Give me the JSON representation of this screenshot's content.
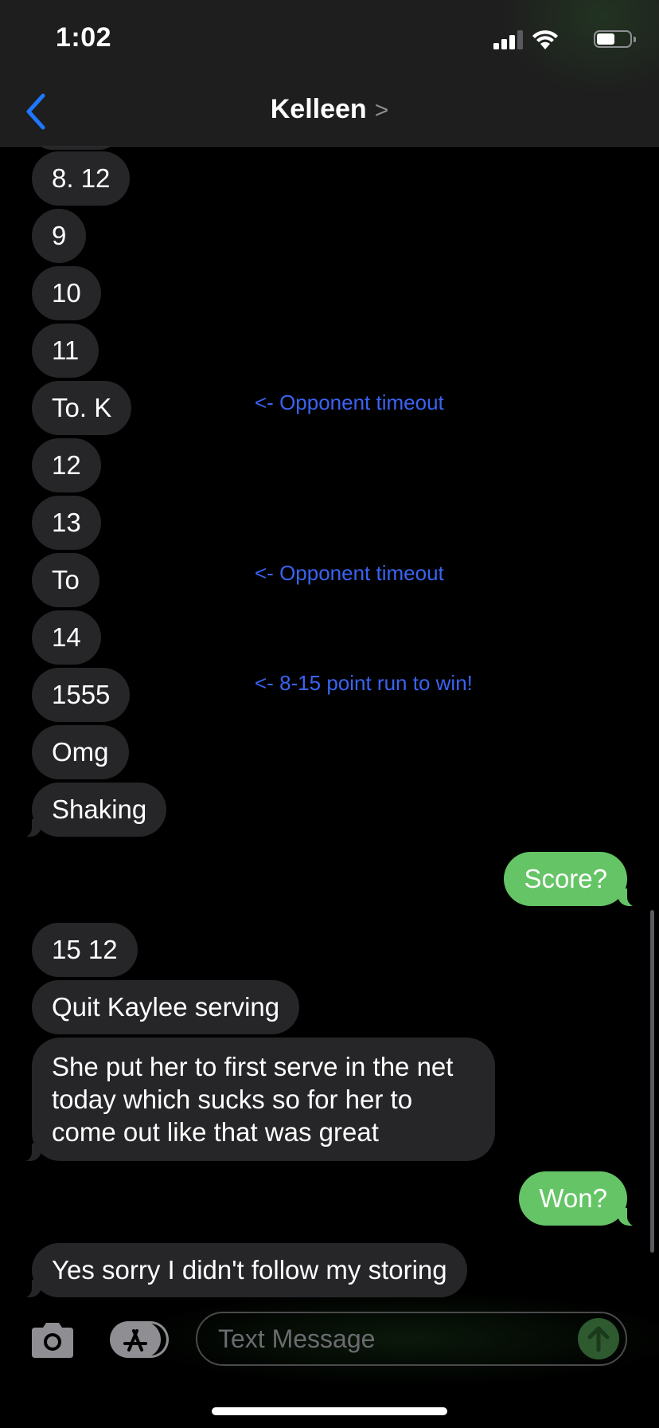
{
  "status_bar": {
    "time": "1:02"
  },
  "header": {
    "contact_name": "Kelleen",
    "chevron": ">"
  },
  "messages": [
    {
      "text": "8.   12"
    },
    {
      "text": "9"
    },
    {
      "text": "10"
    },
    {
      "text": "11"
    },
    {
      "text": "To. K"
    },
    {
      "text": "12"
    },
    {
      "text": "13"
    },
    {
      "text": "To"
    },
    {
      "text": "14"
    },
    {
      "text": "1555"
    },
    {
      "text": "Omg"
    },
    {
      "text": "Shaking"
    },
    {
      "text": "Score?"
    },
    {
      "text": "15 12"
    },
    {
      "text": "Quit Kaylee serving"
    },
    {
      "text": "She put her to first serve in the net today which sucks so for her to come out like that was great"
    },
    {
      "text": "Won?"
    },
    {
      "text": "Yes sorry I didn't follow my storing"
    }
  ],
  "annotations": [
    {
      "text": "<- Opponent timeout"
    },
    {
      "text": "<- Opponent timeout"
    },
    {
      "text": "<- 8-15 point run to win!"
    }
  ],
  "composer": {
    "placeholder": "Text Message"
  },
  "colors": {
    "incoming_bubble": "#262628",
    "outgoing_bubble": "#65c466",
    "annotation": "#3a63f2",
    "accent": "#1e78ff"
  },
  "icons": {
    "back": "chevron-left-icon",
    "camera": "camera-icon",
    "appstore": "app-store-icon",
    "send": "arrow-up-icon"
  }
}
